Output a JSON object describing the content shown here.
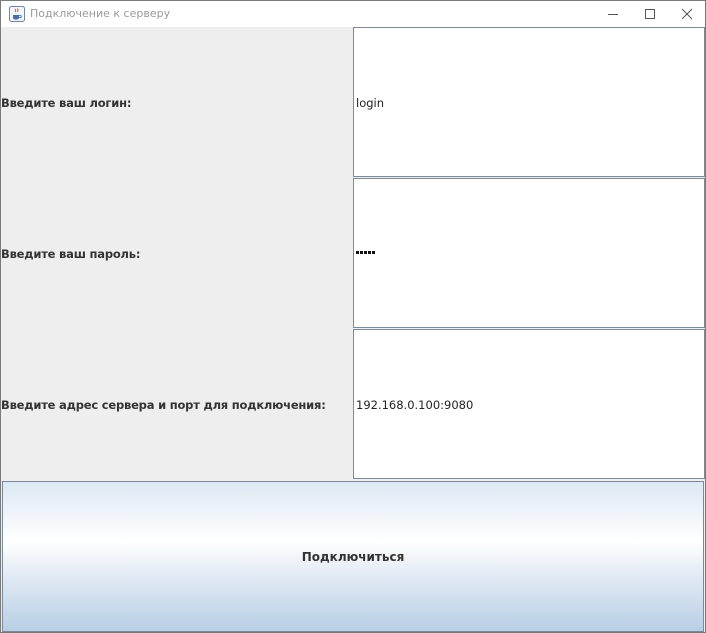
{
  "window": {
    "title": "Подключение к серверу",
    "icon": "java-cup-icon",
    "controls": [
      "minimize-icon",
      "maximize-icon",
      "close-icon"
    ]
  },
  "form": {
    "login": {
      "label": "Введите ваш логин:",
      "value": "login"
    },
    "password": {
      "label": "Введите ваш пароль:",
      "masked_length": 5
    },
    "server": {
      "label": "Введите адрес сервера и порт для подключения:",
      "value": "192.168.0.100:9080"
    }
  },
  "connect_button": {
    "label": "Подключиться"
  },
  "colors": {
    "panel": "#eeeeee",
    "field_border": "#7a8a99",
    "button_gradient_top": "#dde8f3",
    "button_gradient_bottom": "#b8cfe5"
  }
}
